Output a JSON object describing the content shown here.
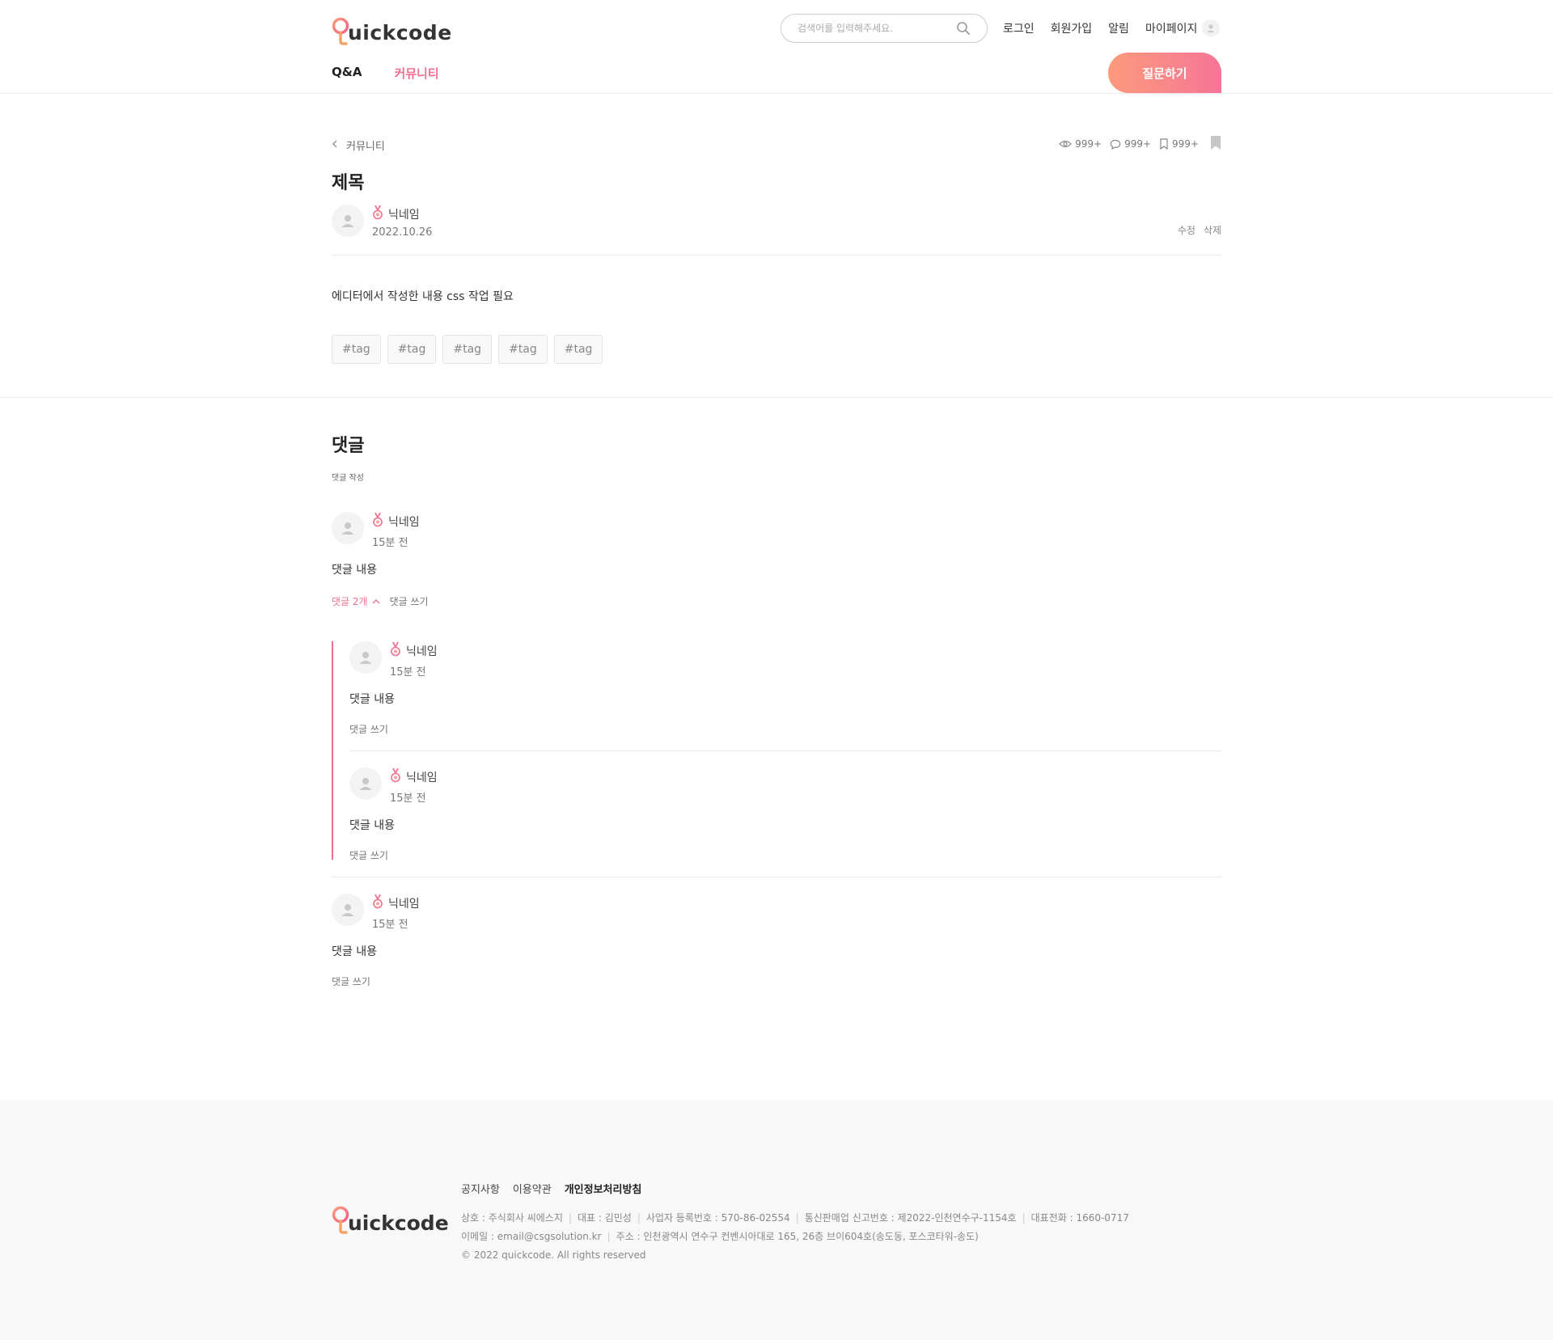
{
  "header": {
    "logo_text": "uickcode",
    "search_placeholder": "검색어를 입력해주세요.",
    "top_links": {
      "login": "로그인",
      "signup": "회원가입",
      "alarm": "알림",
      "mypage": "마이페이지"
    },
    "nav": {
      "qa": "Q&A",
      "community": "커뮤니티"
    },
    "ask_button": "질문하기"
  },
  "post": {
    "breadcrumb": "커뮤니티",
    "stats": {
      "views": "999+",
      "comments": "999+",
      "bookmarks": "999+"
    },
    "title": "제목",
    "author": {
      "nickname": "닉네임",
      "date": "2022.10.26"
    },
    "actions": {
      "edit": "수정",
      "delete": "삭제"
    },
    "content": "에디터에서 작성한 내용 css 작업 필요",
    "tags": [
      "#tag",
      "#tag",
      "#tag",
      "#tag",
      "#tag"
    ]
  },
  "comments": {
    "title": "댓글",
    "write_label": "댓글 작성",
    "items": [
      {
        "nickname": "닉네임",
        "time": "15분 전",
        "body": "댓글 내용",
        "reply_count": "댓글 2개",
        "reply_label": "댓글 쓰기",
        "replies": [
          {
            "nickname": "닉네임",
            "time": "15분 전",
            "body": "댓글 내용",
            "reply_label": "댓글 쓰기"
          },
          {
            "nickname": "닉네임",
            "time": "15분 전",
            "body": "댓글 내용",
            "reply_label": "댓글 쓰기"
          }
        ]
      },
      {
        "nickname": "닉네임",
        "time": "15분 전",
        "body": "댓글 내용",
        "reply_label": "댓글 쓰기"
      }
    ]
  },
  "footer": {
    "logo_text": "uickcode",
    "links": [
      "공지사항",
      "이용약관",
      "개인정보처리방침"
    ],
    "info_line1": [
      "상호 : 주식회사 씨에스지",
      "대표 : 김민성",
      "사업자 등록번호 : 570-86-02554",
      "통신판매업 신고번호 : 제2022-인천연수구-1154호",
      "대표전화 : 1660-0717"
    ],
    "info_line2": [
      "이메일 : email@csgsolution.kr",
      "주소 : 인천광역시 연수구 컨벤시아대로 165, 26층 브이604호(송도동, 포스코타워-송도)"
    ],
    "copyright": "© 2022 quickcode. All rights reserved"
  },
  "colors": {
    "accent": "#f07090",
    "gradient_start": "#fc9a7c",
    "gradient_end": "#f67597"
  }
}
